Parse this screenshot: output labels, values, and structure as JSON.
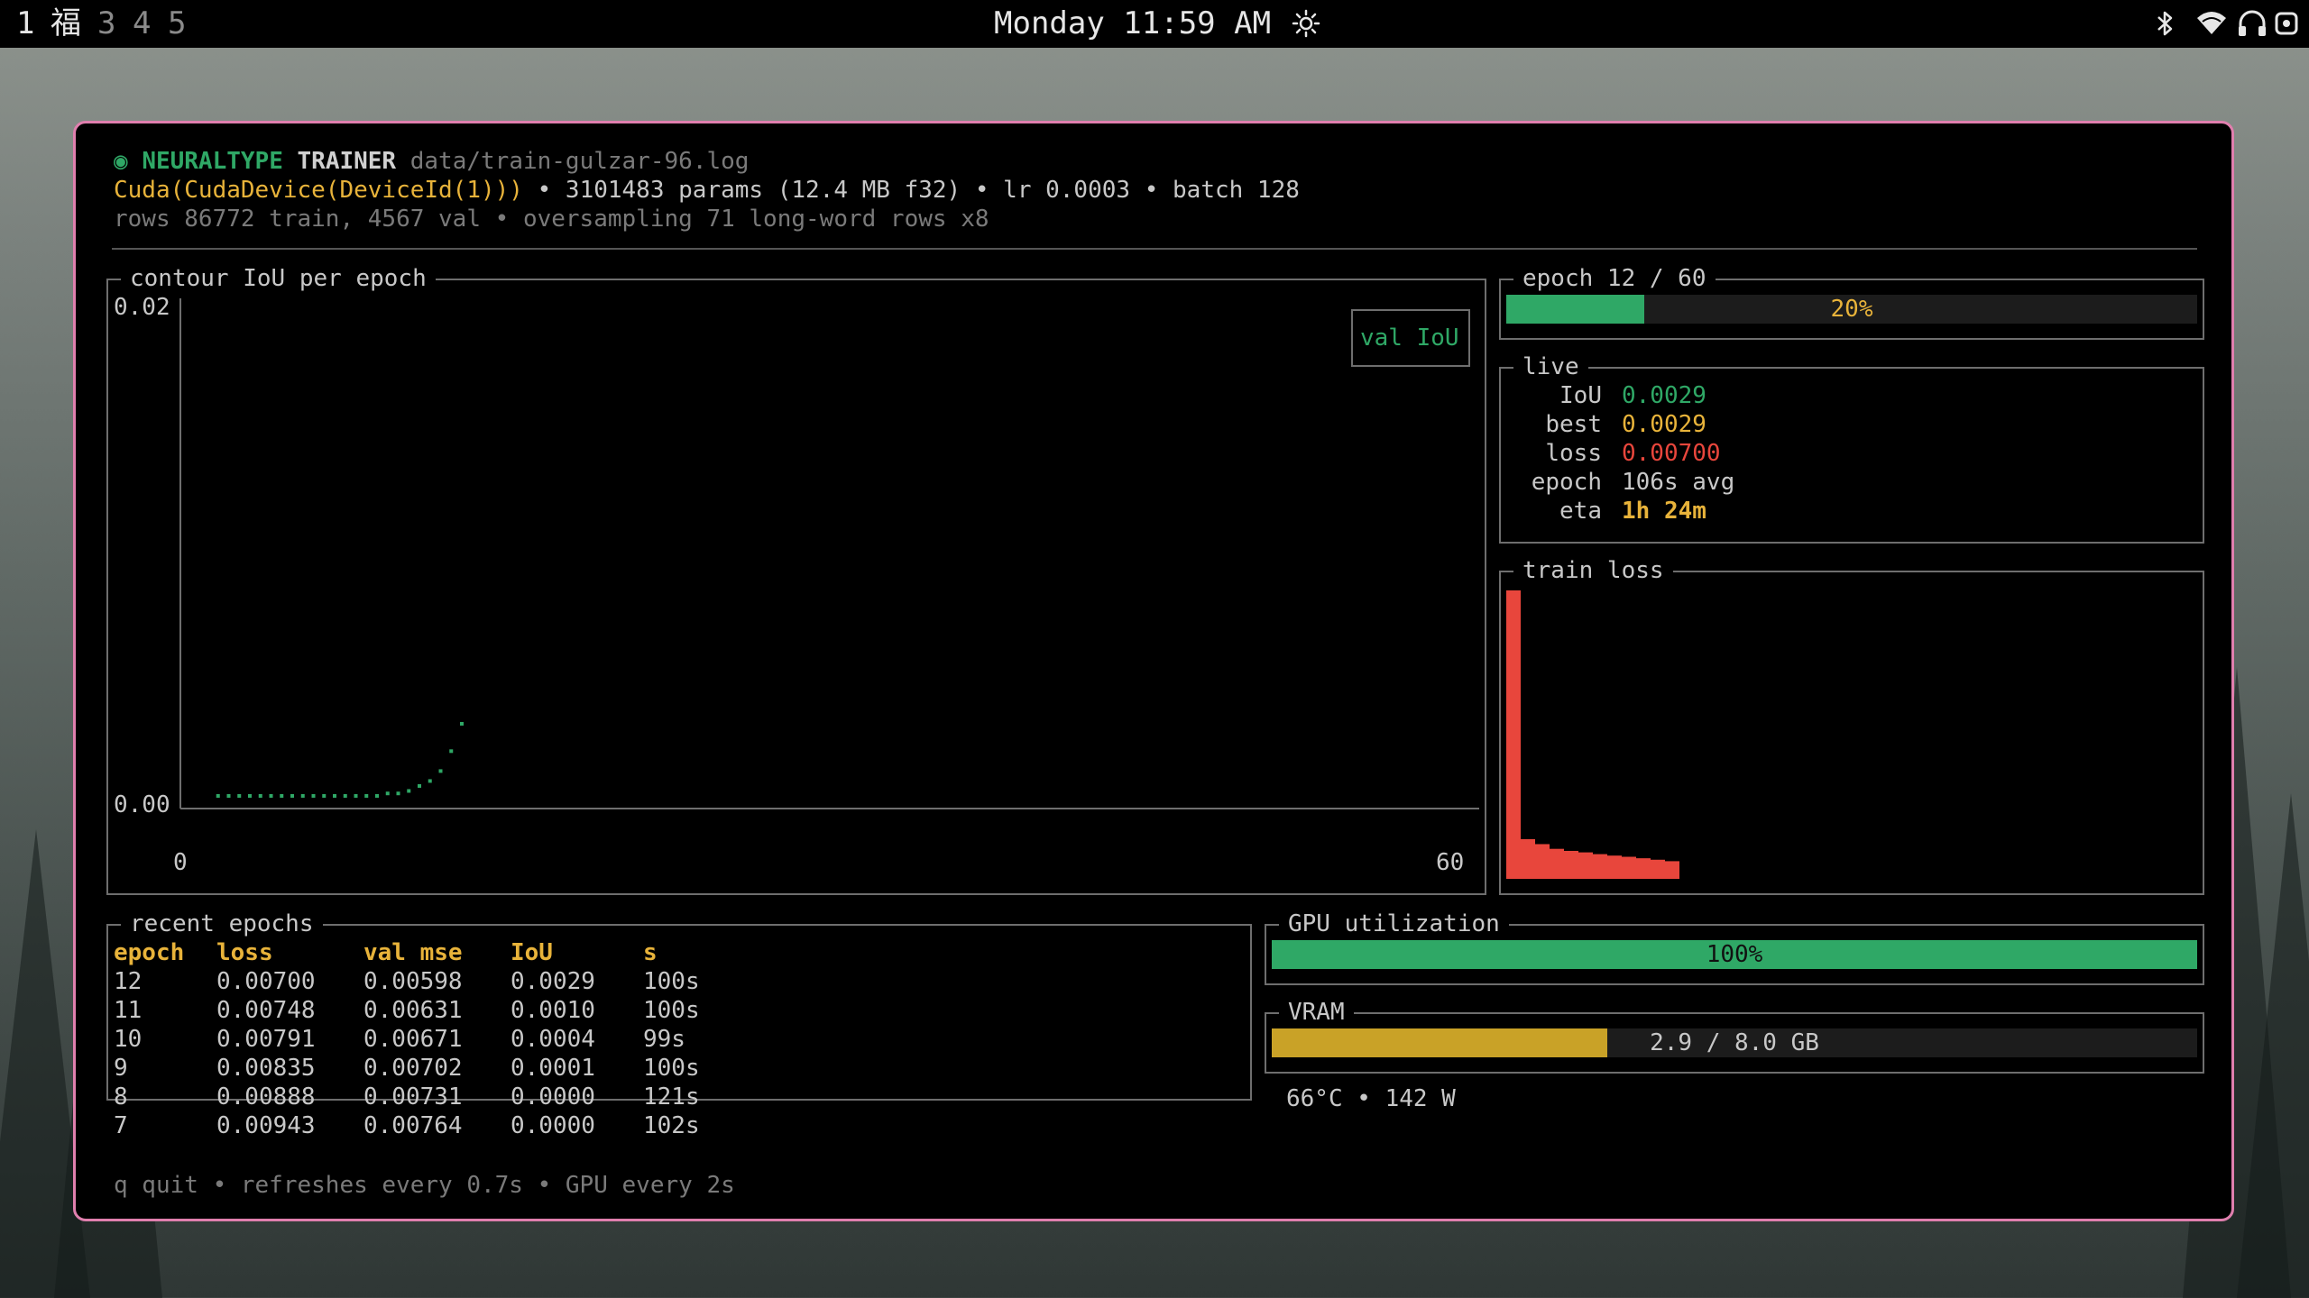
{
  "topbar": {
    "workspaces": [
      "1",
      "福",
      "3",
      "4",
      "5"
    ],
    "clock": "Monday 11:59 AM",
    "icons": [
      "sun-icon",
      "bluetooth-icon",
      "wifi-icon",
      "headphones-icon",
      "settings-icon"
    ]
  },
  "header": {
    "app_name": "NEURALTYPE",
    "app_mode": "TRAINER",
    "log_path": "data/train-gulzar-96.log",
    "device": "Cuda(CudaDevice(DeviceId(1)))",
    "params_info": " • 3101483 params (12.4 MB f32) • lr 0.0003 • batch 128",
    "rows_info": "rows 86772 train, 4567 val • oversampling 71 long-word rows x8"
  },
  "iou_chart": {
    "title": "contour IoU per epoch",
    "legend": "val IoU",
    "y_max_label": "0.02",
    "y_min_label": "0.00",
    "x_min_label": "0",
    "x_max_label": "60"
  },
  "epoch_progress": {
    "title": "epoch 12 / 60",
    "percent_label": "20%",
    "fraction": 0.2
  },
  "live": {
    "title": "live",
    "rows": [
      {
        "label": "IoU",
        "value": "0.0029"
      },
      {
        "label": "best",
        "value": "0.0029"
      },
      {
        "label": "loss",
        "value": "0.00700"
      },
      {
        "label": "epoch",
        "value": "106s avg"
      },
      {
        "label": "eta",
        "value": "1h 24m"
      }
    ]
  },
  "train_loss": {
    "title": "train loss"
  },
  "recent_epochs": {
    "title": "recent epochs",
    "columns": [
      "epoch",
      "loss",
      "val mse",
      "IoU",
      "s"
    ],
    "rows": [
      [
        "12",
        "0.00700",
        "0.00598",
        "0.0029",
        "100s"
      ],
      [
        "11",
        "0.00748",
        "0.00631",
        "0.0010",
        "100s"
      ],
      [
        "10",
        "0.00791",
        "0.00671",
        "0.0004",
        "99s"
      ],
      [
        "9",
        "0.00835",
        "0.00702",
        "0.0001",
        "100s"
      ],
      [
        "8",
        "0.00888",
        "0.00731",
        "0.0000",
        "121s"
      ],
      [
        "7",
        "0.00943",
        "0.00764",
        "0.0000",
        "102s"
      ]
    ]
  },
  "gpu": {
    "title": "GPU utilization",
    "label": "100%",
    "fraction": 1.0
  },
  "vram": {
    "title": "VRAM",
    "label": "2.9 / 8.0 GB",
    "fraction": 0.3625
  },
  "gpu_stats": "66°C • 142 W",
  "footer": "q quit • refreshes every 0.7s • GPU every 2s",
  "chart_data": [
    {
      "type": "scatter",
      "title": "contour IoU per epoch",
      "legend": [
        "val IoU"
      ],
      "xlim": [
        0,
        60
      ],
      "ylim": [
        0,
        0.02
      ],
      "series": [
        {
          "name": "val IoU",
          "x": [
            0.5,
            1,
            1.5,
            2,
            2.5,
            3,
            3.5,
            4,
            4.5,
            5,
            5.5,
            6,
            6.5,
            7,
            7.5,
            8,
            8.5,
            9,
            9.5,
            10,
            10.5,
            11,
            11.5,
            12
          ],
          "y": [
            0,
            0,
            0,
            0,
            0,
            0,
            0,
            0,
            0,
            0,
            0,
            0,
            0,
            0,
            0,
            0,
            0.0001,
            0.0001,
            0.0002,
            0.0004,
            0.0006,
            0.001,
            0.0018,
            0.0029
          ]
        }
      ]
    },
    {
      "type": "bar",
      "title": "train loss",
      "values": [
        0.098,
        0.0135,
        0.0118,
        0.0102,
        0.0095,
        0.009,
        0.0084,
        0.0079,
        0.0075,
        0.007,
        0.0065,
        0.006
      ]
    }
  ]
}
